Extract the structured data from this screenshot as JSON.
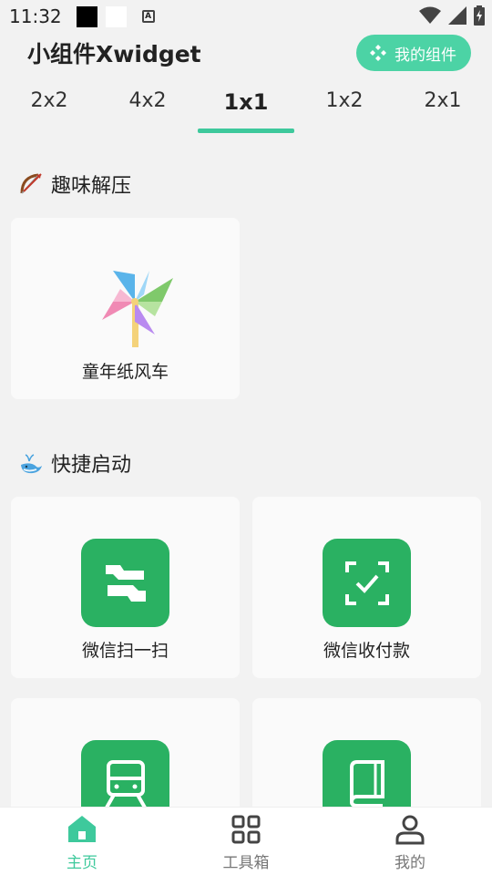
{
  "status_bar": {
    "time": "11:32"
  },
  "header": {
    "title": "小组件Xwidget",
    "my_widgets_label": "我的组件"
  },
  "tabs": [
    {
      "label": "2x2"
    },
    {
      "label": "4x2"
    },
    {
      "label": "1x1"
    },
    {
      "label": "1x2"
    },
    {
      "label": "2x1"
    }
  ],
  "active_tab": "1x1",
  "sections": [
    {
      "title": "趣味解压",
      "emoji": "bow-and-arrow",
      "items": [
        {
          "label": "童年纸风车",
          "icon": "pinwheel-icon"
        }
      ]
    },
    {
      "title": "快捷启动",
      "emoji": "whale",
      "items": [
        {
          "label": "微信扫一扫",
          "icon": "scan-icon"
        },
        {
          "label": "微信收付款",
          "icon": "payment-scan-icon"
        },
        {
          "label": "",
          "icon": "train-icon"
        },
        {
          "label": "",
          "icon": "book-icon"
        }
      ]
    }
  ],
  "bottom_nav": [
    {
      "label": "主页",
      "icon": "home-icon",
      "active": true
    },
    {
      "label": "工具箱",
      "icon": "grid-icon",
      "active": false
    },
    {
      "label": "我的",
      "icon": "user-icon",
      "active": false
    }
  ],
  "colors": {
    "accent": "#3ec99c",
    "button": "#4cd3a5",
    "wechat_green": "#2ab162",
    "background": "#f2f2f2"
  }
}
